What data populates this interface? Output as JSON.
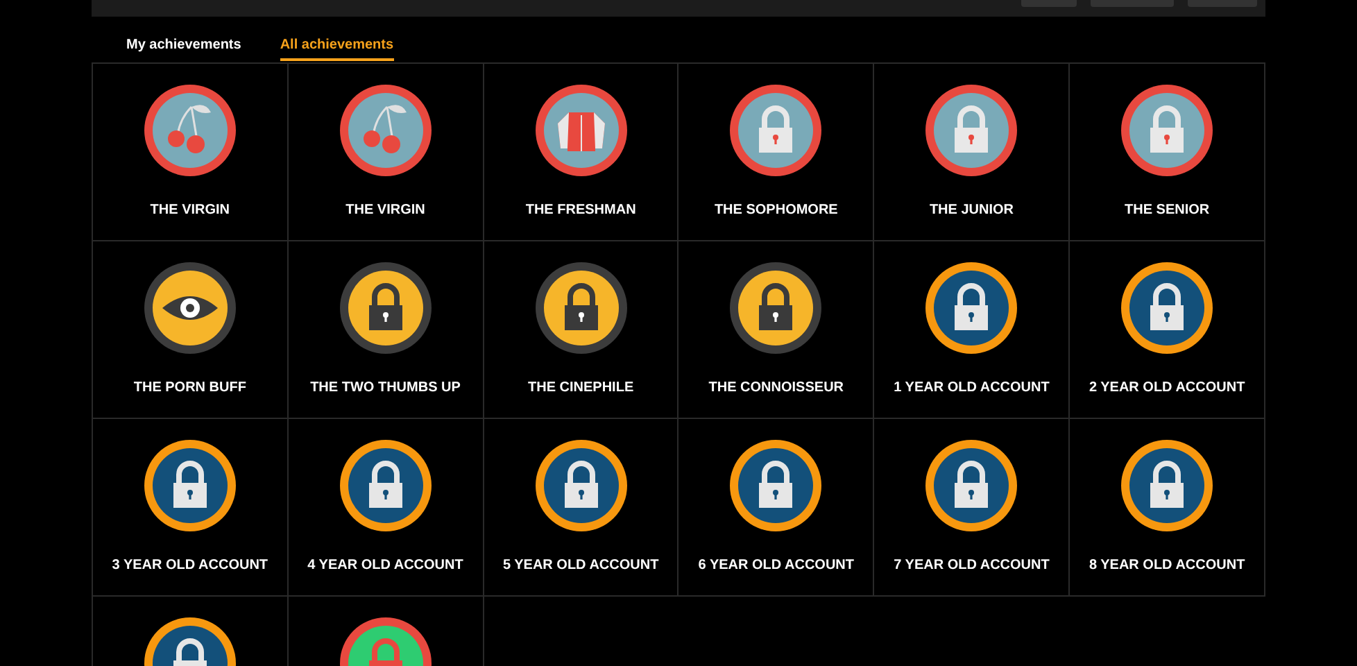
{
  "tabs": [
    {
      "label": "My achievements",
      "selected": false
    },
    {
      "label": "All achievements",
      "selected": true
    }
  ],
  "achievements": [
    {
      "label": "THE VIRGIN",
      "kind": "cherry",
      "color": "#7aaab8"
    },
    {
      "label": "THE VIRGIN",
      "kind": "cherry",
      "color": "#7aaab8"
    },
    {
      "label": "THE FRESHMAN",
      "kind": "jacket",
      "color": "#7aaab8"
    },
    {
      "label": "THE SOPHOMORE",
      "kind": "lock",
      "color": "#7aaab8"
    },
    {
      "label": "THE JUNIOR",
      "kind": "lock",
      "color": "#7aaab8"
    },
    {
      "label": "THE SENIOR",
      "kind": "lock",
      "color": "#7aaab8"
    },
    {
      "label": "THE PORN BUFF",
      "kind": "eye",
      "color": "#f6b52a"
    },
    {
      "label": "THE TWO THUMBS UP",
      "kind": "lock",
      "color": "#f6b52a"
    },
    {
      "label": "THE CINEPHILE",
      "kind": "lock",
      "color": "#f6b52a"
    },
    {
      "label": "THE CONNOISSEUR",
      "kind": "lock",
      "color": "#f6b52a"
    },
    {
      "label": "1 YEAR OLD ACCOUNT",
      "kind": "lock",
      "color": "#13507a"
    },
    {
      "label": "2 YEAR OLD ACCOUNT",
      "kind": "lock",
      "color": "#13507a"
    },
    {
      "label": "3 YEAR OLD ACCOUNT",
      "kind": "lock",
      "color": "#13507a"
    },
    {
      "label": "4 YEAR OLD ACCOUNT",
      "kind": "lock",
      "color": "#13507a"
    },
    {
      "label": "5 YEAR OLD ACCOUNT",
      "kind": "lock",
      "color": "#13507a"
    },
    {
      "label": "6 YEAR OLD ACCOUNT",
      "kind": "lock",
      "color": "#13507a"
    },
    {
      "label": "7 YEAR OLD ACCOUNT",
      "kind": "lock",
      "color": "#13507a"
    },
    {
      "label": "8 YEAR OLD ACCOUNT",
      "kind": "lock",
      "color": "#13507a"
    },
    {
      "kind": "lock",
      "color": "#13507a"
    },
    {
      "kind": "lock",
      "color": "#2ecc71"
    }
  ]
}
